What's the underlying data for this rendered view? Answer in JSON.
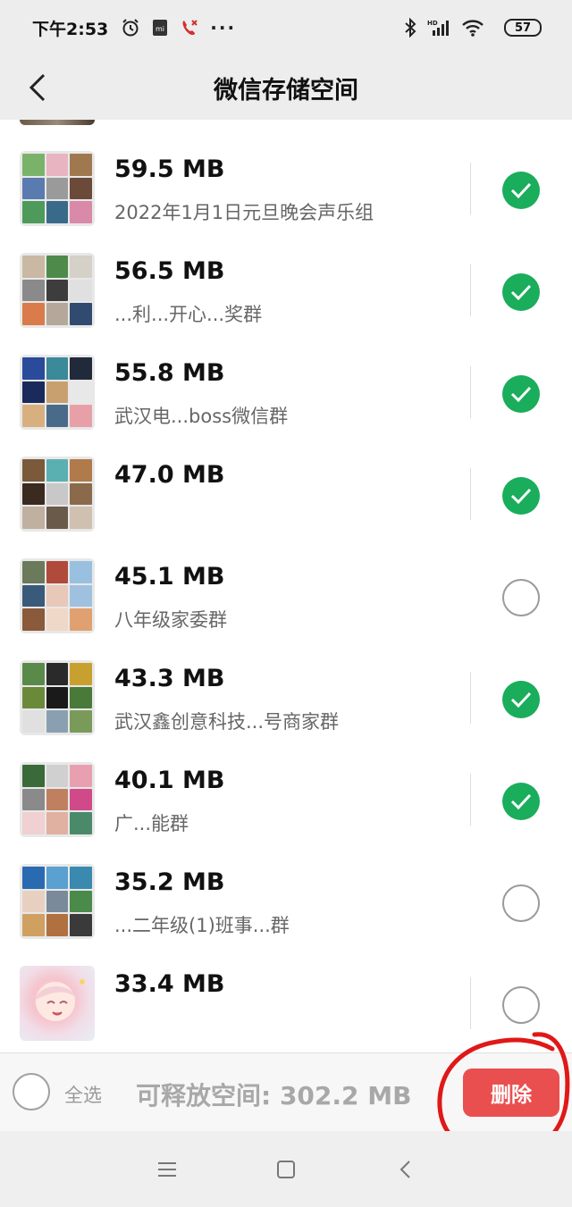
{
  "status_bar": {
    "time": "下午2:53",
    "more": "···",
    "battery": "57",
    "icons": [
      "alarm-icon",
      "mi-app-icon",
      "missed-call-icon",
      "bluetooth-icon",
      "hd-signal-icon",
      "wifi-icon",
      "battery-icon"
    ]
  },
  "header": {
    "title": "微信存储空间",
    "back_icon": "back-chevron-icon"
  },
  "items": [
    {
      "size": "59.5 MB",
      "name": "2022年1月1日元旦晚会声乐组",
      "checked": true
    },
    {
      "size": "56.5 MB",
      "name": "...利...开心...奖群",
      "checked": true
    },
    {
      "size": "55.8 MB",
      "name": "武汉电...boss微信群",
      "checked": true
    },
    {
      "size": "47.0 MB",
      "name": "",
      "checked": true
    },
    {
      "size": "45.1 MB",
      "name": "八年级家委群",
      "checked": false
    },
    {
      "size": "43.3 MB",
      "name": "武汉鑫创意科技...号商家群",
      "checked": true
    },
    {
      "size": "40.1 MB",
      "name": "广...能群",
      "checked": true
    },
    {
      "size": "35.2 MB",
      "name": "...二年级(1)班事...群",
      "checked": false
    },
    {
      "size": "33.4 MB",
      "name": "",
      "checked": false
    }
  ],
  "footer": {
    "select_all": "全选",
    "free_space": "可释放空间: 302.2 MB",
    "delete": "删除"
  },
  "colors": {
    "accent_green": "#1aad5b",
    "delete_red": "#ea4f4f",
    "annotation_red": "#e01818"
  }
}
